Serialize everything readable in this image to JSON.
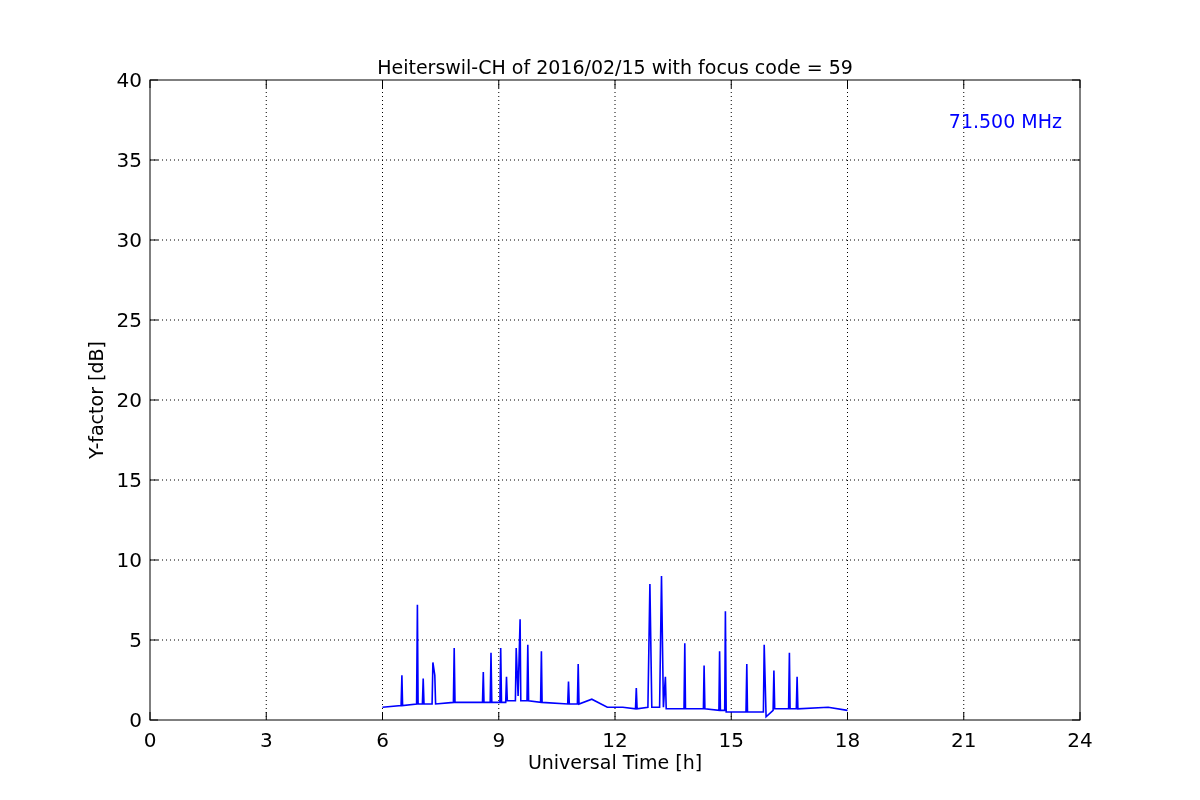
{
  "chart_data": {
    "type": "line",
    "title": "Heiterswil-CH of 2016/02/15 with focus code = 59",
    "xlabel": "Universal Time [h]",
    "ylabel": "Y-factor [dB]",
    "grid": true,
    "xlim": [
      0,
      24
    ],
    "ylim": [
      0,
      40
    ],
    "xticks": [
      0,
      3,
      6,
      9,
      12,
      15,
      18,
      21,
      24
    ],
    "yticks": [
      0,
      5,
      10,
      15,
      20,
      25,
      30,
      35,
      40
    ],
    "x": [
      6.0,
      6.48,
      6.5,
      6.52,
      6.88,
      6.9,
      6.92,
      7.03,
      7.05,
      7.07,
      7.28,
      7.3,
      7.35,
      7.37,
      7.83,
      7.85,
      7.87,
      8.58,
      8.6,
      8.62,
      8.78,
      8.8,
      8.82,
      9.03,
      9.05,
      9.07,
      9.18,
      9.2,
      9.22,
      9.43,
      9.45,
      9.5,
      9.55,
      9.57,
      9.73,
      9.75,
      9.77,
      10.08,
      10.1,
      10.12,
      10.78,
      10.8,
      10.82,
      11.03,
      11.05,
      11.07,
      11.4,
      11.8,
      12.2,
      12.53,
      12.55,
      12.57,
      12.85,
      12.9,
      12.95,
      13.15,
      13.2,
      13.25,
      13.3,
      13.32,
      13.78,
      13.8,
      13.82,
      14.28,
      14.3,
      14.32,
      14.68,
      14.7,
      14.72,
      14.83,
      14.85,
      14.87,
      15.38,
      15.4,
      15.42,
      15.83,
      15.85,
      15.9,
      16.08,
      16.1,
      16.12,
      16.48,
      16.5,
      16.52,
      16.68,
      16.7,
      16.72,
      17.5,
      18.0
    ],
    "series": [
      {
        "color": "#0000ff",
        "values": [
          0.8,
          0.9,
          2.8,
          0.9,
          1.0,
          7.2,
          1.0,
          1.0,
          2.6,
          1.0,
          1.0,
          3.6,
          2.8,
          1.0,
          1.1,
          4.5,
          1.1,
          1.1,
          3.0,
          1.1,
          1.1,
          4.2,
          1.1,
          1.1,
          4.5,
          1.1,
          1.1,
          2.7,
          1.2,
          1.2,
          4.5,
          1.5,
          6.3,
          1.2,
          1.2,
          4.7,
          1.2,
          1.1,
          4.3,
          1.1,
          1.0,
          2.4,
          1.0,
          1.0,
          3.5,
          1.0,
          1.3,
          0.8,
          0.8,
          0.7,
          2.0,
          0.7,
          0.8,
          8.5,
          0.8,
          0.8,
          9.0,
          0.8,
          2.7,
          0.7,
          0.7,
          4.8,
          0.7,
          0.7,
          3.4,
          0.7,
          0.6,
          4.3,
          0.6,
          0.6,
          6.8,
          0.5,
          0.5,
          3.5,
          0.5,
          0.5,
          4.7,
          0.2,
          0.6,
          3.1,
          0.7,
          0.7,
          4.2,
          0.7,
          0.7,
          2.7,
          0.7,
          0.8,
          0.6
        ]
      }
    ],
    "annotations": [
      "71.500 MHz"
    ]
  }
}
